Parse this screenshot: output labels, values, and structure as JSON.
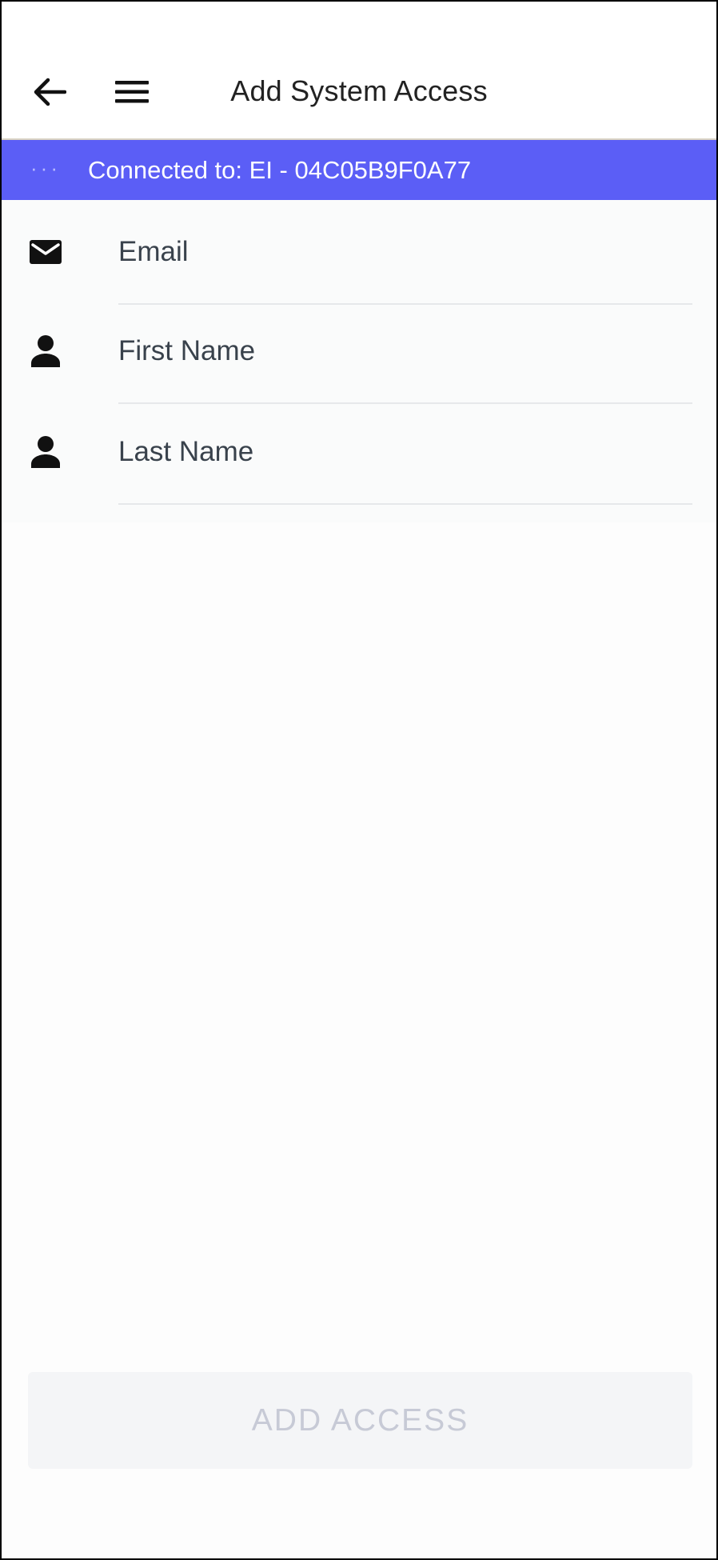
{
  "header": {
    "title": "Add System Access",
    "back_icon": "arrow-left-icon",
    "menu_icon": "hamburger-menu-icon"
  },
  "connection": {
    "indicator": "···",
    "text": "Connected to: EI - 04C05B9F0A77",
    "color": "#5b5ef6"
  },
  "form": {
    "fields": [
      {
        "icon": "envelope-icon",
        "placeholder": "Email",
        "value": ""
      },
      {
        "icon": "person-icon",
        "placeholder": "First Name",
        "value": ""
      },
      {
        "icon": "person-icon",
        "placeholder": "Last Name",
        "value": ""
      }
    ]
  },
  "actions": {
    "add_access_label": "ADD ACCESS",
    "enabled": false
  }
}
